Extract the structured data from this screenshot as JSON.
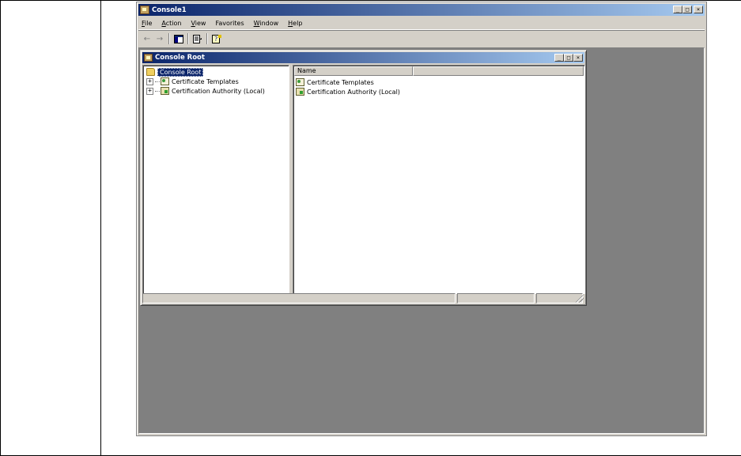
{
  "window": {
    "title": "Console1",
    "buttons": {
      "minimize": "_",
      "maximize": "□",
      "close": "×"
    }
  },
  "menubar": [
    {
      "key": "F",
      "rest": "ile"
    },
    {
      "key": "A",
      "rest": "ction"
    },
    {
      "key": "V",
      "rest": "iew"
    },
    {
      "key": "",
      "rest": "Favorites"
    },
    {
      "key": "W",
      "rest": "indow"
    },
    {
      "key": "H",
      "rest": "elp"
    }
  ],
  "toolbar": {
    "back_glyph": "←",
    "forward_glyph": "→"
  },
  "child_window": {
    "title": "Console Root"
  },
  "tree": {
    "root_label": "Console Root",
    "items": [
      {
        "label": "Certificate Templates",
        "expander": "+"
      },
      {
        "label": "Certification Authority (Local)",
        "expander": "+"
      }
    ]
  },
  "list": {
    "columns": [
      "Name",
      ""
    ],
    "rows": [
      {
        "name": "Certificate Templates"
      },
      {
        "name": "Certification Authority (Local)"
      }
    ]
  },
  "colors": {
    "titlebar_start": "#0a246a",
    "titlebar_end": "#a6caf0",
    "face": "#d4d0c8",
    "workspace": "#808080"
  },
  "icons": {
    "app": "mmc-console-icon",
    "root": "console-root-folder-icon",
    "cert_templates": "certificate-templates-icon",
    "ca": "certification-authority-icon"
  }
}
